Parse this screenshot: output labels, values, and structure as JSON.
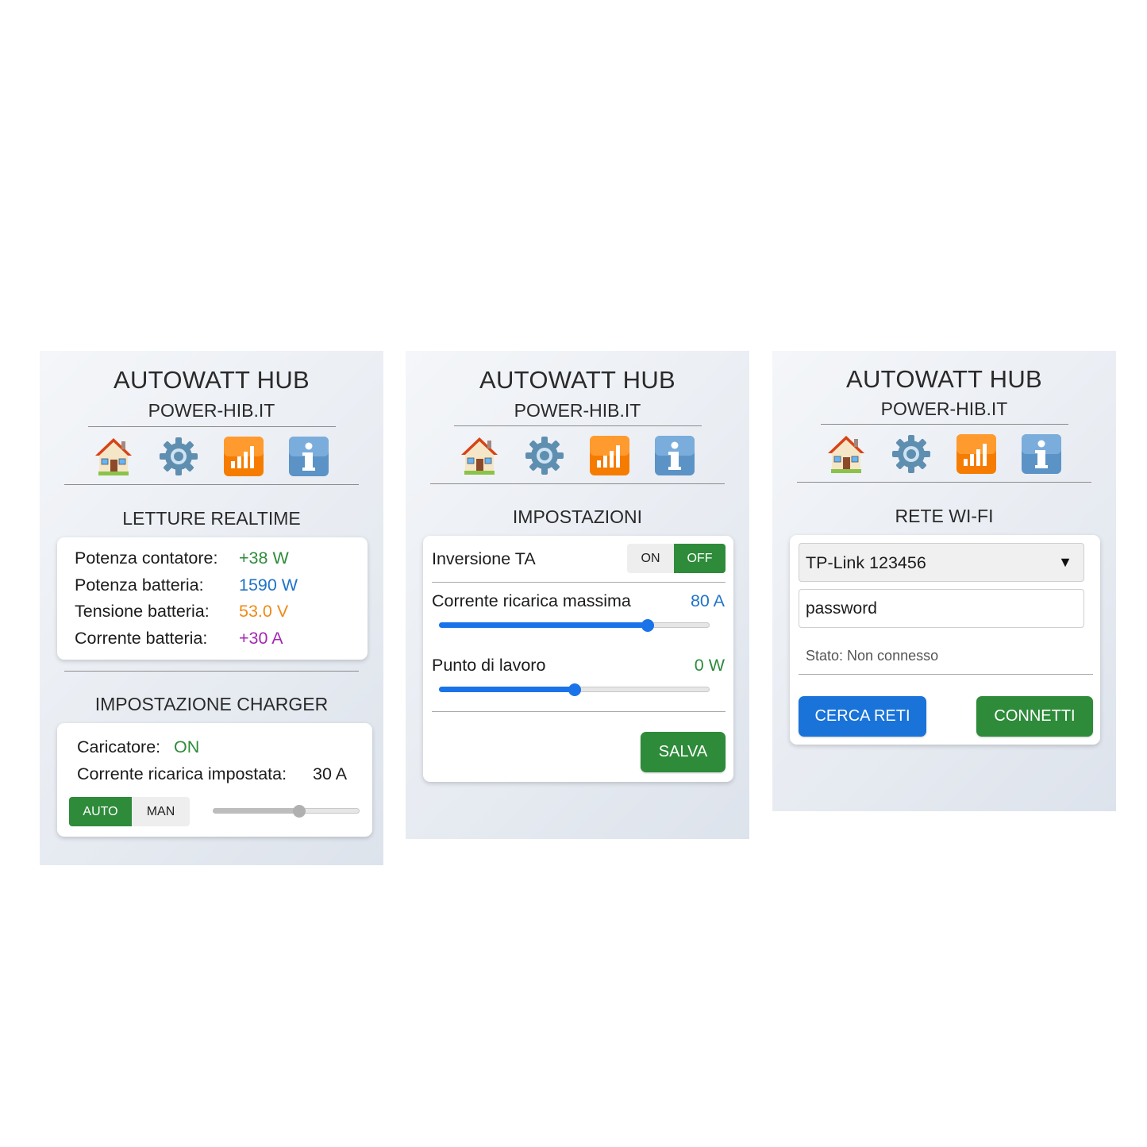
{
  "colors": {
    "green": "#2e8b3a",
    "blue": "#1f73c9",
    "orange": "#ef8a17",
    "purple": "#a326b3",
    "button_green": "#2e8b3a",
    "button_blue": "#1a73d9",
    "slider_blue": "#1a73e8"
  },
  "header": {
    "title": "AUTOWATT HUB",
    "subtitle": "POWER-HIB.IT",
    "nav_icons": [
      "house-icon",
      "gear-icon",
      "signal-bars-icon",
      "info-icon"
    ]
  },
  "realtime": {
    "section_title": "LETTURE REALTIME",
    "rows": [
      {
        "label": "Potenza contatore:",
        "value": "+38 W",
        "color": "green"
      },
      {
        "label": "Potenza batteria:",
        "value": "1590 W",
        "color": "blue"
      },
      {
        "label": "Tensione batteria:",
        "value": "53.0 V",
        "color": "orange"
      },
      {
        "label": "Corrente batteria:",
        "value": "+30 A",
        "color": "purple"
      }
    ]
  },
  "charger": {
    "section_title": "IMPOSTAZIONE CHARGER",
    "status_label": "Caricatore:",
    "status_value": "ON",
    "current_label": "Corrente ricarica impostata:",
    "current_value": "30 A",
    "mode_auto": "AUTO",
    "mode_man": "MAN",
    "selected_mode": "AUTO",
    "slider_level": 0.59
  },
  "settings": {
    "section_title": "IMPOSTAZIONI",
    "inversion_label": "Inversione TA",
    "toggle_on": "ON",
    "toggle_off": "OFF",
    "toggle_selected": "OFF",
    "max_current_label": "Corrente ricarica massima",
    "max_current_value": "80 A",
    "max_current_level": 0.77,
    "workpoint_label": "Punto di lavoro",
    "workpoint_value": "0 W",
    "workpoint_level": 0.5,
    "save_label": "SALVA"
  },
  "wifi": {
    "section_title": "RETE WI-FI",
    "selected_network": "TP-Link 123456",
    "dropdown_arrow": "▼",
    "password_value": "password",
    "status_text": "Stato: Non connesso",
    "scan_label": "CERCA RETI",
    "connect_label": "CONNETTI"
  }
}
